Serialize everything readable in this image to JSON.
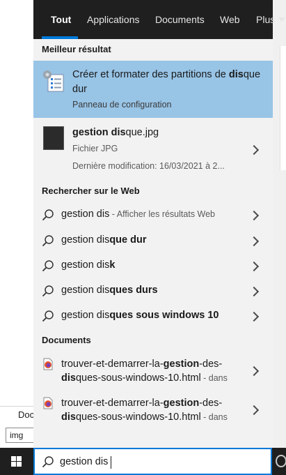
{
  "tabs": [
    {
      "label": "Tout"
    },
    {
      "label": "Applications"
    },
    {
      "label": "Documents"
    },
    {
      "label": "Web"
    },
    {
      "label": "Plus"
    }
  ],
  "best_match": {
    "section": "Meilleur résultat",
    "title_pre": "Créer et formater des partitions de ",
    "title_bold": "dis",
    "title_post": "que dur",
    "subtitle": "Panneau de configuration"
  },
  "file_result": {
    "name_bold": "gestion dis",
    "name_rest": "que.jpg",
    "type": "Fichier JPG",
    "modified": "Dernière modification: 16/03/2021 à 2..."
  },
  "web": {
    "section": "Rechercher sur le Web",
    "items": [
      {
        "pre": "gestion dis",
        "bold": "",
        "suffix": " - Afficher les résultats Web"
      },
      {
        "pre": "gestion dis",
        "bold": "que dur",
        "suffix": ""
      },
      {
        "pre": "gestion dis",
        "bold": "k",
        "suffix": ""
      },
      {
        "pre": "gestion dis",
        "bold": "ques durs",
        "suffix": ""
      },
      {
        "pre": "gestion dis",
        "bold": "ques sous windows 10",
        "suffix": ""
      }
    ]
  },
  "documents": {
    "section": "Documents",
    "items": [
      {
        "l1_pre": "trouver-et-demarrer-la-",
        "l1_bold": "gestion",
        "l1_post": "-des-",
        "l2_bold": "dis",
        "l2_post": "ques-sous-windows-10.html",
        "l2_gray": " - dans"
      },
      {
        "l1_pre": "trouver-et-demarrer-la-",
        "l1_bold": "gestion",
        "l1_post": "-des-",
        "l2_bold": "dis",
        "l2_post": "ques-sous-windows-10.html",
        "l2_gray": " - dans"
      }
    ]
  },
  "search": {
    "value": "gestion dis"
  },
  "background": {
    "doc_label": "Doc",
    "img_label": "img"
  },
  "colors": {
    "accent": "#0078d7",
    "highlight": "#98c4e6",
    "tabbar": "#1f1f1f",
    "panel": "#f2f2f2"
  }
}
